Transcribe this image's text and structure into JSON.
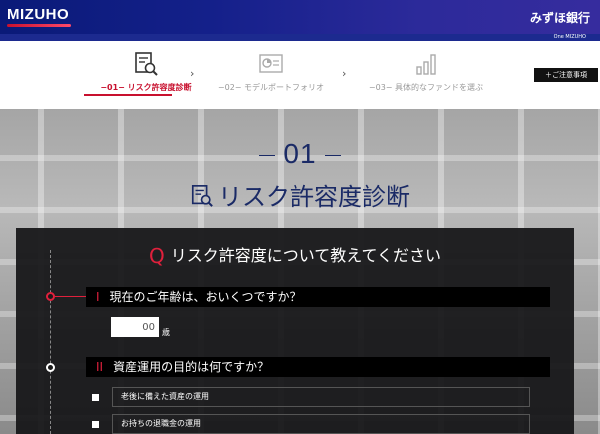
{
  "header": {
    "logo": "MIZUHO",
    "bank_name": "みずほ銀行",
    "sub_brand": "One MIZUHO"
  },
  "steps": [
    {
      "label": "−01− リスク許容度診断",
      "active": true,
      "icon": "diagnosis-icon"
    },
    {
      "label": "−02− モデルポートフォリオ",
      "active": false,
      "icon": "portfolio-chart-icon"
    },
    {
      "label": "−03− 具体的なファンドを選ぶ",
      "active": false,
      "icon": "bar-chart-icon"
    }
  ],
  "notice_button": "＋ご注意事項",
  "section": {
    "number": "01",
    "title": "リスク許容度診断"
  },
  "panel": {
    "q_mark": "Q",
    "heading": "リスク許容度について教えてください",
    "questions": [
      {
        "num": "I",
        "text": "現在のご年齢は、おいくつですか？"
      },
      {
        "num": "II",
        "text": "資産運用の目的は何ですか？"
      }
    ],
    "age_value": "00",
    "age_unit": "歳",
    "options": [
      "老後に備えた資産の運用",
      "お持ちの退職金の運用"
    ]
  },
  "colors": {
    "accent": "#c8102e",
    "navy": "#1a2a66"
  }
}
